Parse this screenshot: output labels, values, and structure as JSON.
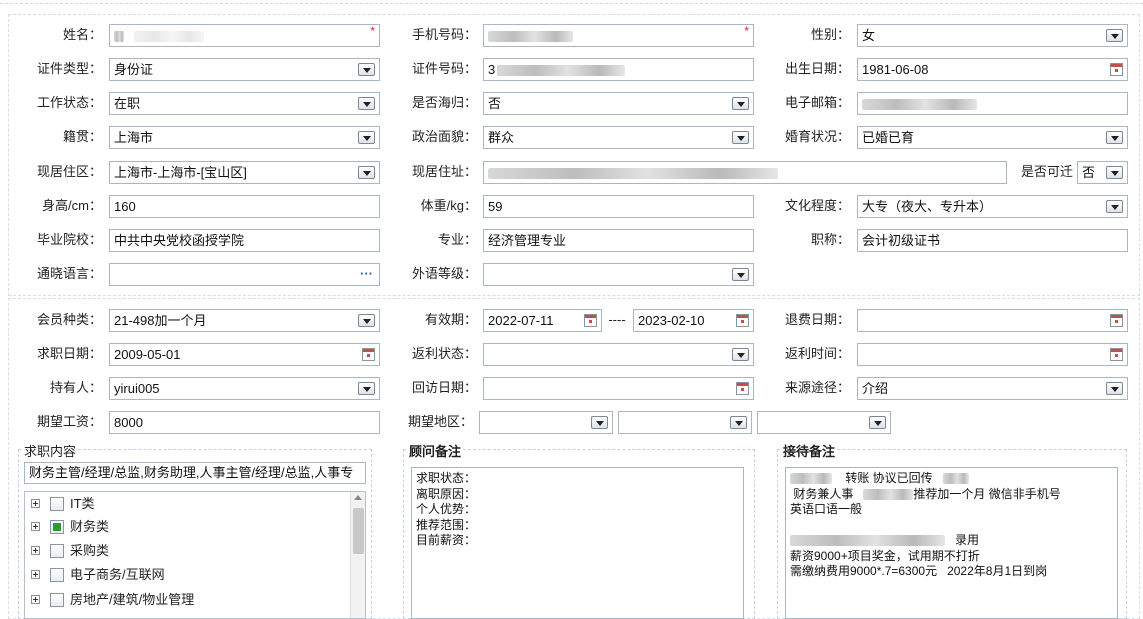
{
  "personal": {
    "name": {
      "label": "姓名：",
      "value": ""
    },
    "phone": {
      "label": "手机号码：",
      "value": ""
    },
    "gender": {
      "label": "性别：",
      "value": "女"
    },
    "id_type": {
      "label": "证件类型：",
      "value": "身份证"
    },
    "id_number": {
      "label": "证件号码：",
      "value": "3"
    },
    "birth_date": {
      "label": "出生日期：",
      "value": "1981-06-08"
    },
    "work_status": {
      "label": "工作状态：",
      "value": "在职"
    },
    "returnee": {
      "label": "是否海归：",
      "value": "否"
    },
    "email": {
      "label": "电子邮箱：",
      "value": ""
    },
    "native_place": {
      "label": "籍贯：",
      "value": "上海市"
    },
    "political": {
      "label": "政治面貌：",
      "value": "群众"
    },
    "marital": {
      "label": "婚育状况：",
      "value": "已婚已育"
    },
    "residence_area": {
      "label": "现居住区：",
      "value": "上海市-上海市-[宝山区]"
    },
    "address": {
      "label": "现居住址：",
      "value": ""
    },
    "relocate": {
      "label": "是否可迁",
      "value": "否"
    },
    "height": {
      "label": "身高/cm：",
      "value": "160"
    },
    "weight": {
      "label": "体重/kg：",
      "value": "59"
    },
    "education": {
      "label": "文化程度：",
      "value": "大专（夜大、专升本）"
    },
    "school": {
      "label": "毕业院校：",
      "value": "中共中央党校函授学院"
    },
    "major": {
      "label": "专业：",
      "value": "经济管理专业"
    },
    "title": {
      "label": "职称：",
      "value": "会计初级证书"
    },
    "languages": {
      "label": "通晓语言：",
      "value": ""
    },
    "foreign_level": {
      "label": "外语等级：",
      "value": ""
    }
  },
  "membership": {
    "member_type": {
      "label": "会员种类：",
      "value": "21-498加一个月"
    },
    "valid_period": {
      "label": "有效期：",
      "start": "2022-07-11",
      "separator": "----",
      "end": "2023-02-10"
    },
    "refund_date": {
      "label": "退费日期：",
      "value": ""
    },
    "job_search_date": {
      "label": "求职日期：",
      "value": "2009-05-01"
    },
    "rebate_status": {
      "label": "返利状态：",
      "value": ""
    },
    "rebate_time": {
      "label": "返利时间：",
      "value": ""
    },
    "holder": {
      "label": "持有人：",
      "value": "yirui005"
    },
    "followup_date": {
      "label": "回访日期：",
      "value": ""
    },
    "source": {
      "label": "来源途径：",
      "value": "介绍"
    },
    "expected_salary": {
      "label": "期望工资：",
      "value": "8000"
    },
    "expected_region": {
      "label": "期望地区：",
      "values": [
        "",
        "",
        ""
      ]
    }
  },
  "job_content": {
    "title": "求职内容",
    "summary": "财务主管/经理/总监,财务助理,人事主管/经理/总监,人事专",
    "tree": [
      {
        "label": "IT类",
        "checked": false
      },
      {
        "label": "财务类",
        "checked": true
      },
      {
        "label": "采购类",
        "checked": false
      },
      {
        "label": "电子商务/互联网",
        "checked": false
      },
      {
        "label": "房地产/建筑/物业管理",
        "checked": false
      }
    ]
  },
  "consultant_notes": {
    "title": "顾问备注",
    "lines": [
      "求职状态：",
      "离职原因：",
      "个人优势：",
      "推荐范围：",
      "目前薪资："
    ]
  },
  "reception_notes": {
    "title": "接待备注",
    "line1": "转账 协议已回传",
    "line2a": "财务兼人事",
    "line2b": "推荐加一个月 微信非手机号",
    "line3": "英语口语一般",
    "line5": "录用",
    "line6": "薪资9000+项目奖金，试用期不打折",
    "line7": "需缴纳费用9000*.7=6300元   2022年8月1日到岗"
  },
  "colors": {
    "required": "#e02020",
    "border": "#a9b6c4",
    "checked": "#2e9a36"
  }
}
